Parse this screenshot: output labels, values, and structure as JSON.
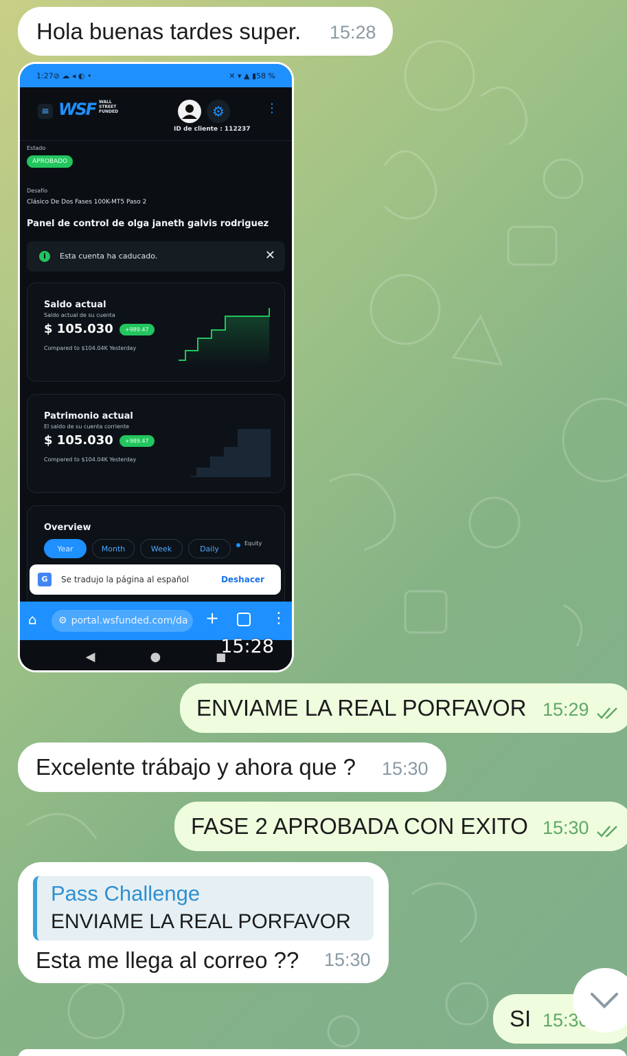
{
  "messages": {
    "m1": {
      "text": "Hola buenas tardes super.",
      "time": "15:28"
    },
    "screenshot_time": "15:28",
    "m2": {
      "text": "ENVIAME LA REAL PORFAVOR",
      "time": "15:29"
    },
    "m3": {
      "text": "Excelente trábajo y ahora que ?",
      "time": "15:30"
    },
    "m4": {
      "text": "FASE 2 APROBADA CON EXITO",
      "time": "15:30"
    },
    "m5": {
      "reply_author": "Pass Challenge",
      "reply_text": "ENVIAME LA REAL PORFAVOR",
      "text": "Esta me llega al correo ??",
      "time": "15:30"
    },
    "m6": {
      "text": "SI",
      "time": "15:30"
    }
  },
  "screenshot": {
    "status_time": "1:27",
    "battery": "58 %",
    "logo_tagline": "WALL STREET FUNDED",
    "client_id": "ID de cliente : 112237",
    "estado_label": "Estado",
    "estado_value": "APROBADO",
    "desafio_label": "Desafío",
    "desafio_value": "Clásico De Dos Fases 100K-MT5 Paso 2",
    "panel_title": "Panel de control de olga janeth galvis rodriguez",
    "alert_text": "Esta cuenta ha caducado.",
    "balance": {
      "title": "Saldo actual",
      "subtitle": "Saldo actual de su cuenta",
      "amount": "$ 105.030",
      "delta": "+989.47",
      "compare": "Compared to $104.04K Yesterday"
    },
    "equity": {
      "title": "Patrimonio actual",
      "subtitle": "El saldo de su cuenta corriente",
      "amount": "$ 105.030",
      "delta": "+989.47",
      "compare": "Compared to $104.04K Yesterday"
    },
    "overview": {
      "title": "Overview",
      "tabs": [
        "Year",
        "Month",
        "Week",
        "Daily"
      ],
      "legend": "Equity"
    },
    "translate_toast": {
      "text": "Se tradujo la página al español",
      "action": "Deshacer"
    },
    "url": "portal.wsfunded.com/da"
  },
  "colors": {
    "incoming_bubble": "#ffffff",
    "outgoing_bubble": "#effdde",
    "outgoing_time": "#5fa867",
    "accent_blue": "#1e90ff",
    "approved_green": "#22c55e"
  }
}
